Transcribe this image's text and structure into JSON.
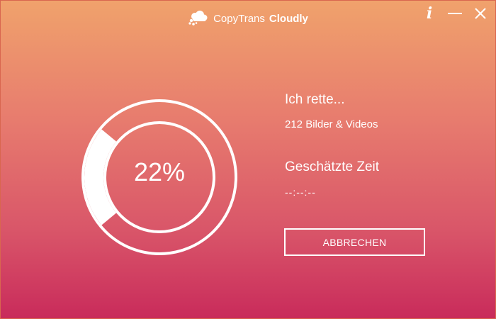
{
  "app": {
    "brand_light": "CopyTrans",
    "brand_bold": "Cloudly"
  },
  "window_controls": {
    "info_icon": "info-icon",
    "minimize_icon": "minimize-icon",
    "close_icon": "close-icon"
  },
  "progress": {
    "percent_label": "22%",
    "value": 0.22
  },
  "status": {
    "heading": "Ich rette...",
    "items": "212 Bilder & Videos",
    "time_heading": "Geschätzte Zeit",
    "time_value": "--:--:--"
  },
  "actions": {
    "cancel_label": "ABBRECHEN"
  },
  "colors": {
    "gradient_top": "#f0a26c",
    "gradient_bottom": "#c92b5b",
    "foreground": "#ffffff"
  }
}
